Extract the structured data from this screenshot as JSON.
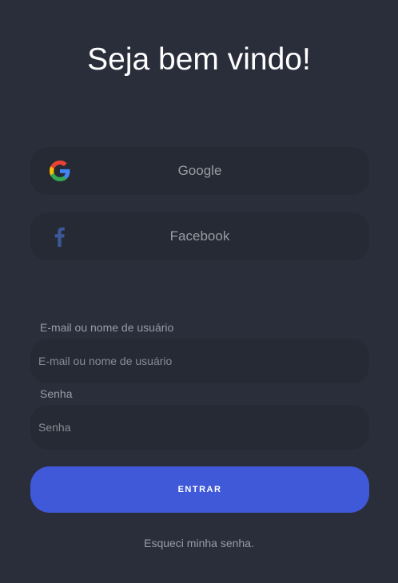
{
  "title": "Seja bem vindo!",
  "social": {
    "google": {
      "label": "Google",
      "icon": "google-icon"
    },
    "facebook": {
      "label": "Facebook",
      "icon": "facebook-icon",
      "color": "#3b5998"
    }
  },
  "form": {
    "email": {
      "label": "E-mail ou nome de usuário",
      "placeholder": "E-mail ou nome de usuário",
      "value": ""
    },
    "password": {
      "label": "Senha",
      "placeholder": "Senha",
      "value": ""
    },
    "submit_label": "ENTRAR",
    "submit_color": "#4059d8"
  },
  "forgot_password": "Esqueci minha senha."
}
